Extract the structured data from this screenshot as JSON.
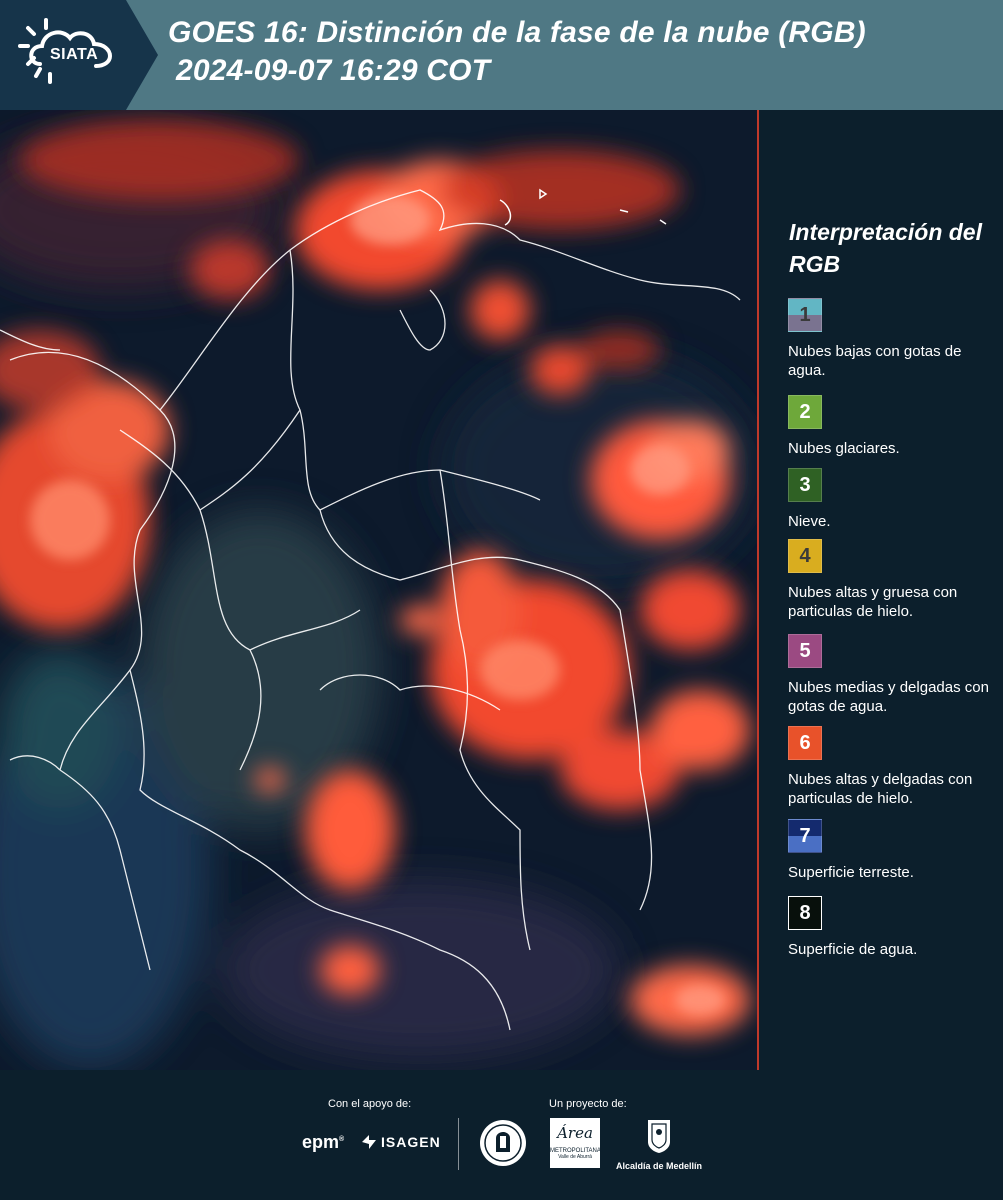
{
  "header": {
    "title_line1": "GOES 16: Distinción de la fase de la nube (RGB)",
    "title_line2": "2024-09-07 16:29 COT",
    "logo_text": "SIATA",
    "bg_color": "#4f7884"
  },
  "legend": {
    "title": "Interpretación del RGB",
    "items": [
      {
        "number": "1",
        "label": "Nubes bajas con gotas de agua.",
        "color_top": "#62b6c4",
        "color_bottom": "#7a7390",
        "number_color": "#3a3a3a"
      },
      {
        "number": "2",
        "label": "Nubes glaciares.",
        "color_top": "#6ea83a",
        "color_bottom": "#6ea83a",
        "number_color": "#ffffff"
      },
      {
        "number": "3",
        "label": "Nieve.",
        "color_top": "#2f6124",
        "color_bottom": "#2f6124",
        "number_color": "#ffffff"
      },
      {
        "number": "4",
        "label": "Nubes altas y gruesa con particulas de hielo.",
        "color_top": "#d9ad1f",
        "color_bottom": "#d9ad1f",
        "number_color": "#3a3a3a"
      },
      {
        "number": "5",
        "label": "Nubes medias y delgadas con gotas de agua.",
        "color_top": "#9b4a82",
        "color_bottom": "#9b4a82",
        "number_color": "#ffffff"
      },
      {
        "number": "6",
        "label": "Nubes altas y delgadas con particulas de hielo.",
        "color_top": "#e8522a",
        "color_bottom": "#e8522a",
        "number_color": "#ffffff"
      },
      {
        "number": "7",
        "label": "Superficie terreste.",
        "color_top": "#142a6e",
        "color_bottom": "#4a6fc4",
        "number_color": "#ffffff"
      },
      {
        "number": "8",
        "label": "Superficie de agua.",
        "color_top": "#08100c",
        "color_bottom": "#08100c",
        "number_color": "#ffffff"
      }
    ]
  },
  "footer": {
    "support_label": "Con el apoyo de:",
    "project_label": "Un proyecto de:",
    "logos": {
      "epm": "epm",
      "isagen": "ISAGEN",
      "area_title": "Área",
      "area_sub1": "METROPOLITANA",
      "area_sub2": "Valle de Aburrá",
      "alcaldia": "Alcaldía de Medellín"
    }
  }
}
